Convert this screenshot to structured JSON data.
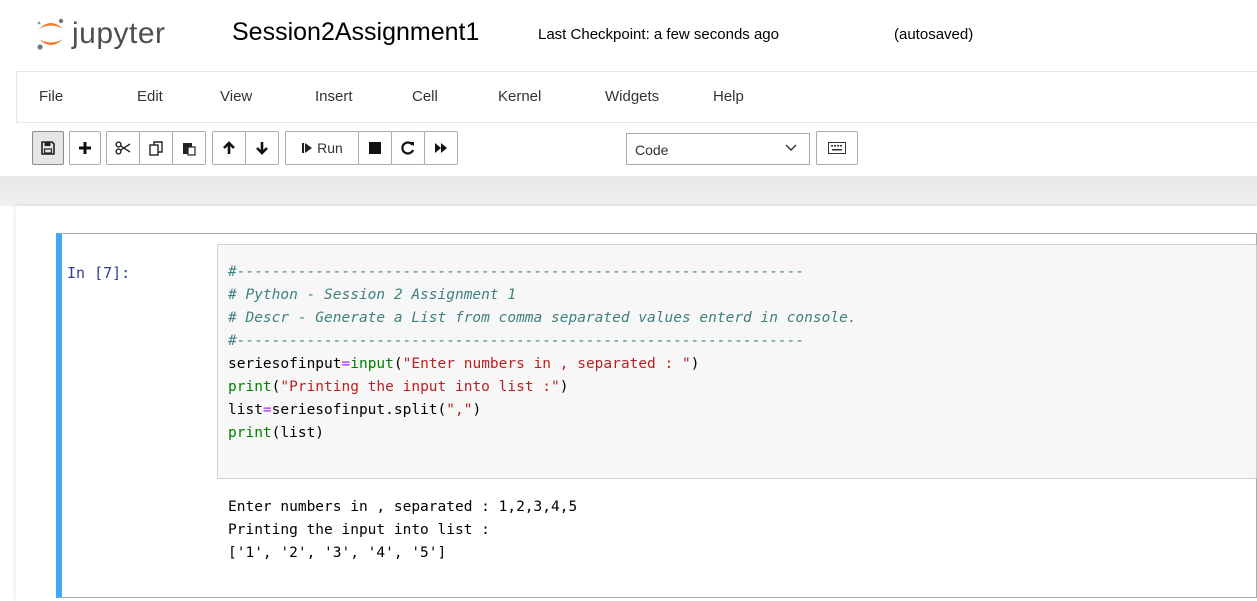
{
  "header": {
    "logo_text": "jupyter",
    "notebook_name": "Session2Assignment1",
    "checkpoint": "Last Checkpoint: a few seconds ago",
    "autosave_status": "(autosaved)"
  },
  "menu": [
    "File",
    "Edit",
    "View",
    "Insert",
    "Cell",
    "Kernel",
    "Widgets",
    "Help"
  ],
  "toolbar": {
    "run_label": "Run",
    "cell_type": "Code",
    "icons": [
      "save-icon",
      "plus-icon",
      "scissors-icon",
      "copy-icon",
      "paste-icon",
      "arrow-up-icon",
      "arrow-down-icon",
      "step-forward-icon",
      "stop-icon",
      "restart-icon",
      "fast-forward-icon",
      "chevron-down-icon",
      "keyboard-icon"
    ]
  },
  "cell": {
    "prompt": "In [7]:",
    "code_lines": [
      "#-----------------------------------------------------------------",
      "# Python - Session 2 Assignment 1",
      "# Descr - Generate a List from comma separated values enterd in console.",
      "#-----------------------------------------------------------------",
      "seriesofinput=input(\"Enter numbers in , separated : \")",
      "print(\"Printing the input into list :\")",
      "list=seriesofinput.split(\",\")",
      "print(list)"
    ],
    "output_lines": [
      "Enter numbers in , separated : 1,2,3,4,5",
      "Printing the input into list :",
      "['1', '2', '3', '4', '5']"
    ]
  },
  "colors": {
    "selected_cell_border": "#42a5f5",
    "prompt": "#303f9f",
    "comment": "#408080",
    "builtin": "#008000",
    "string": "#ba2121",
    "operator": "#aa22ff"
  }
}
